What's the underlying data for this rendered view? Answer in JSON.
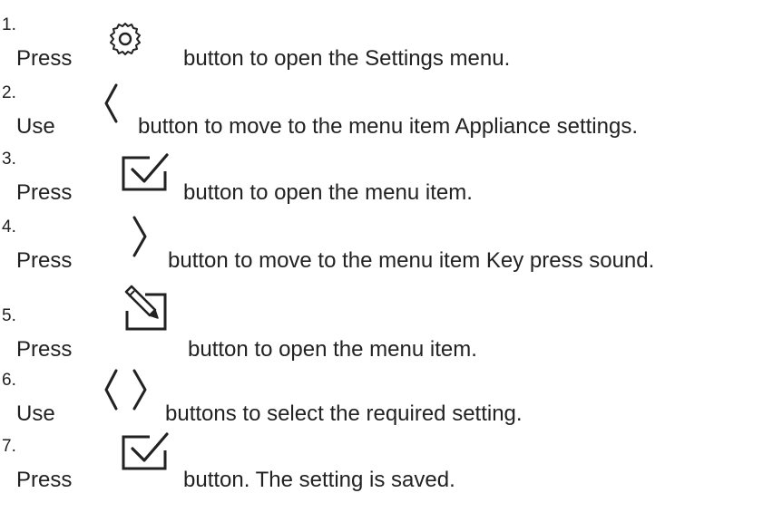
{
  "steps": [
    {
      "number": "1.",
      "verb": "Press",
      "icons": [
        "gear-icon"
      ],
      "text": "button to open the Settings menu."
    },
    {
      "number": "2.",
      "verb": "Use",
      "icons": [
        "chevron-left-icon"
      ],
      "text": "button to move to the menu item Appliance settings."
    },
    {
      "number": "3.",
      "verb": "Press",
      "icons": [
        "checkbox-confirm-icon"
      ],
      "text": "button to open the menu item."
    },
    {
      "number": "4.",
      "verb": "Press",
      "icons": [
        "chevron-right-icon"
      ],
      "text": "button to move to the menu item Key press sound."
    },
    {
      "number": "5.",
      "verb": "Press",
      "icons": [
        "edit-pencil-icon"
      ],
      "text": "button to open the menu item."
    },
    {
      "number": "6.",
      "verb": "Use",
      "icons": [
        "chevron-left-icon",
        "chevron-right-icon"
      ],
      "text": "buttons to select the required setting."
    },
    {
      "number": "7.",
      "verb": "Press",
      "icons": [
        "checkbox-confirm-icon"
      ],
      "text": "button. The setting is saved."
    }
  ]
}
